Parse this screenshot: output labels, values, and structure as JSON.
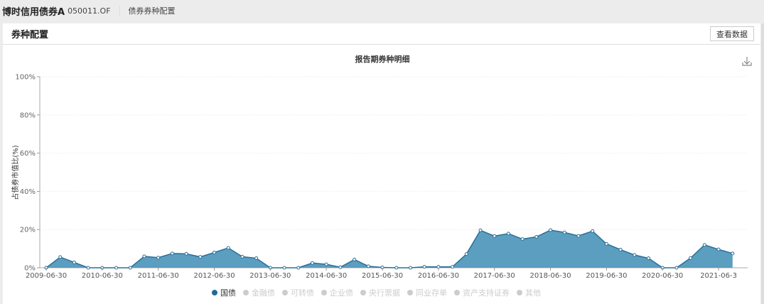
{
  "header": {
    "fund_name": "博时信用债券A",
    "fund_code": "050011.OF",
    "breadcrumb": "债券券种配置"
  },
  "panel": {
    "title": "券种配置",
    "view_data_button": "查看数据"
  },
  "colors": {
    "series": "#5b9ec0",
    "line": "#2a6f97",
    "active_legend": "#1f6d9a",
    "inactive_legend": "#cccccc"
  },
  "chart_data": {
    "type": "area",
    "title": "报告期券种明细",
    "ylabel": "占债券市值比(%)",
    "xlabel": "",
    "ylim": [
      0,
      100
    ],
    "yticks": [
      "0%",
      "20%",
      "40%",
      "60%",
      "80%",
      "100%"
    ],
    "xtick_labels": [
      "2009-06-30",
      "2010-06-30",
      "2011-06-30",
      "2012-06-30",
      "2013-06-30",
      "2014-06-30",
      "2015-06-30",
      "2016-06-30",
      "2017-06-30",
      "2018-06-30",
      "2019-06-30",
      "2020-06-30",
      "2021-06-3"
    ],
    "grid": true,
    "legend_position": "bottom",
    "legend": [
      {
        "name": "国债",
        "active": true
      },
      {
        "name": "金融债",
        "active": false
      },
      {
        "name": "可转债",
        "active": false
      },
      {
        "name": "企业债",
        "active": false
      },
      {
        "name": "央行票据",
        "active": false
      },
      {
        "name": "同业存单",
        "active": false
      },
      {
        "name": "资产支持证券",
        "active": false
      },
      {
        "name": "其他",
        "active": false
      }
    ],
    "x": [
      "2009-06-30",
      "2009-09-30",
      "2009-12-31",
      "2010-03-31",
      "2010-06-30",
      "2010-09-30",
      "2010-12-31",
      "2011-03-31",
      "2011-06-30",
      "2011-09-30",
      "2011-12-31",
      "2012-03-31",
      "2012-06-30",
      "2012-09-30",
      "2012-12-31",
      "2013-03-31",
      "2013-06-30",
      "2013-09-30",
      "2013-12-31",
      "2014-03-31",
      "2014-06-30",
      "2014-09-30",
      "2014-12-31",
      "2015-03-31",
      "2015-06-30",
      "2015-09-30",
      "2015-12-31",
      "2016-03-31",
      "2016-06-30",
      "2016-09-30",
      "2016-12-31",
      "2017-03-31",
      "2017-06-30",
      "2017-09-30",
      "2017-12-31",
      "2018-03-31",
      "2018-06-30",
      "2018-09-30",
      "2018-12-31",
      "2019-03-31",
      "2019-06-30",
      "2019-09-30",
      "2019-12-31",
      "2020-03-31",
      "2020-06-30",
      "2020-09-30",
      "2020-12-31",
      "2021-03-31",
      "2021-06-30",
      "2021-09-30"
    ],
    "series": [
      {
        "name": "国债",
        "values": [
          0,
          5.6,
          2.8,
          0,
          0,
          0,
          0,
          6.0,
          5.3,
          7.5,
          7.3,
          5.7,
          8.0,
          10.4,
          5.8,
          5.0,
          0,
          0,
          0,
          2.5,
          1.8,
          0.3,
          4.3,
          0.8,
          0.2,
          0,
          0,
          0.5,
          0.5,
          0.5,
          7.2,
          19.6,
          16.6,
          17.9,
          15.0,
          16.2,
          19.7,
          18.5,
          16.7,
          19.2,
          12.5,
          9.5,
          6.7,
          5.0,
          0,
          0,
          5.1,
          12.0,
          9.6,
          7.5
        ]
      }
    ]
  }
}
